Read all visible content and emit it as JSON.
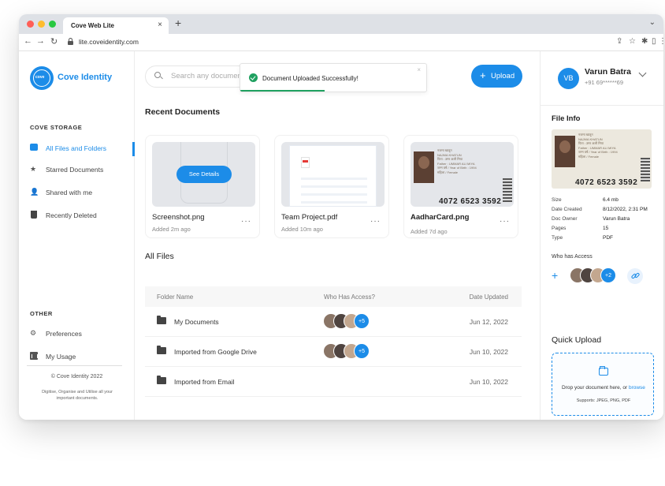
{
  "browser": {
    "tab_title": "Cove Web Lite",
    "tab_close": "×",
    "new_tab": "+",
    "url": "lite.coveidentity.com"
  },
  "sidebar": {
    "logo_mark": "cove",
    "brand": "Cove Identity",
    "storage_label": "COVE STORAGE",
    "items": [
      {
        "label": "All Files and Folders",
        "icon": "folder-icon",
        "active": true
      },
      {
        "label": "Starred Documents",
        "icon": "star-icon"
      },
      {
        "label": "Shared with me",
        "icon": "user-plus-icon"
      },
      {
        "label": "Recently Deleted",
        "icon": "trash-icon"
      }
    ],
    "other_label": "OTHER",
    "other_items": [
      {
        "label": "Preferences",
        "icon": "gear-icon"
      },
      {
        "label": "My Usage",
        "icon": "bar-chart-icon"
      }
    ],
    "copyright": "© Cove Identity 2022",
    "tagline": "Digitise, Organise and Utilise all your important documents."
  },
  "main": {
    "search_placeholder": "Search any document",
    "toast": {
      "message": "Document Uploaded Successfully!",
      "progress": 0.45
    },
    "upload_label": "Upload",
    "recent_title": "Recent Documents",
    "recent": [
      {
        "name": "Screenshot.png",
        "added": "Added 2m ago",
        "action": "See Details"
      },
      {
        "name": "Team Project.pdf",
        "added": "Added 10m ago"
      },
      {
        "name": "AadharCard.png",
        "added": "Added 7d ago"
      }
    ],
    "all_files_title": "All Files",
    "table": {
      "headers": [
        "Folder Name",
        "Who Has Access?",
        "Date Updated"
      ],
      "rows": [
        {
          "name": "My Documents",
          "extra": "+5",
          "date": "Jun 12, 2022"
        },
        {
          "name": "Imported from Google Drive",
          "extra": "+5",
          "date": "Jun 10, 2022"
        },
        {
          "name": "Imported from Email",
          "date": "Jun 10, 2022"
        }
      ]
    }
  },
  "id_card": {
    "lines": [
      "नजमा खातून",
      "NAJMA KHATUN",
      "पिता : उमर अली मिया",
      "Father : UMMAR ALI MIYA",
      "जन्म वर्ष / Year of Birth : 1994",
      "महिला / Female"
    ],
    "number": "4072 6523 3592"
  },
  "right": {
    "initials": "VB",
    "user_name": "Varun Batra",
    "user_phone": "+91 69******69",
    "file_info_title": "File Info",
    "meta": [
      {
        "label": "Size",
        "value": "6.4 mb"
      },
      {
        "label": "Date Created",
        "value": "8/12/2022, 2:31 PM"
      },
      {
        "label": "Doc Owner",
        "value": "Varun Batra"
      },
      {
        "label": "Pages",
        "value": "15"
      },
      {
        "label": "Type",
        "value": "PDF"
      }
    ],
    "who_has_access": "Who has Access",
    "extra_access": "+2",
    "quick_upload_title": "Quick Upload",
    "drop_text": "Drop your document here, or",
    "browse": "browse",
    "supports": "Supports: JPEG, PNG, PDF"
  },
  "colors": {
    "accent": "#1c8ce8",
    "success": "#1fa060"
  }
}
